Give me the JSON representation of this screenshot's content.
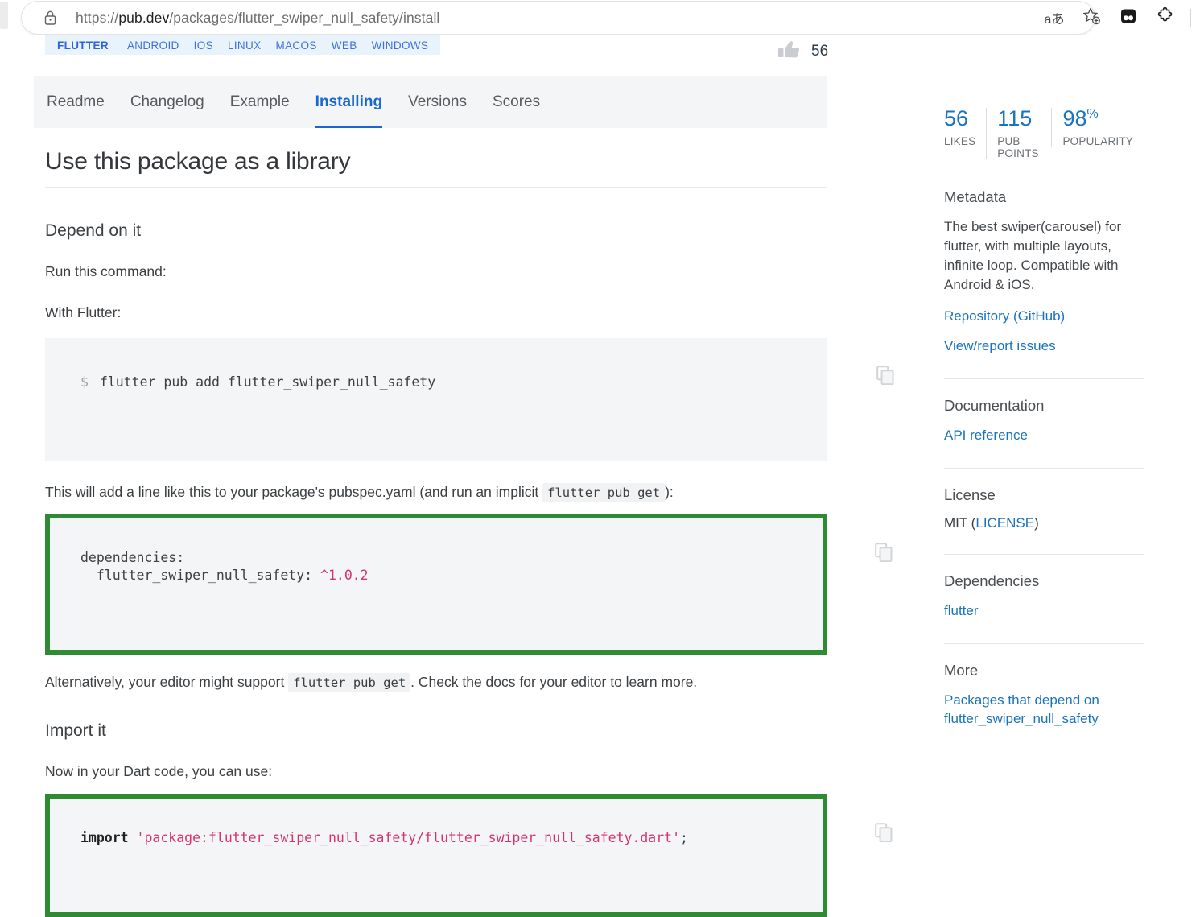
{
  "browser": {
    "url_scheme": "https://",
    "url_host": "pub.dev",
    "url_path": "/packages/flutter_swiper_null_safety/install",
    "url_full": "https://pub.dev/packages/flutter_swiper_null_safety/install",
    "actions": {
      "read_aloud_label": "aあ",
      "favorite_label": "add-favorite",
      "collections_label": "collections",
      "extensions_label": "extensions"
    }
  },
  "platforms": {
    "primary": "FLUTTER",
    "items": [
      "ANDROID",
      "IOS",
      "LINUX",
      "MACOS",
      "WEB",
      "WINDOWS"
    ]
  },
  "likes": {
    "icon": "thumb-up-icon",
    "count": "56"
  },
  "tabs": [
    {
      "label": "Readme",
      "active": false
    },
    {
      "label": "Changelog",
      "active": false
    },
    {
      "label": "Example",
      "active": false
    },
    {
      "label": "Installing",
      "active": true
    },
    {
      "label": "Versions",
      "active": false
    },
    {
      "label": "Scores",
      "active": false
    }
  ],
  "main": {
    "title": "Use this package as a library",
    "depend_heading": "Depend on it",
    "run_command_label": "Run this command:",
    "with_flutter_label": "With Flutter:",
    "command_prompt": "$",
    "command_text": "flutter pub add flutter_swiper_null_safety",
    "pubspec_note_before": "This will add a line like this to your package's pubspec.yaml (and run an implicit ",
    "pubspec_note_code": "flutter pub get",
    "pubspec_note_after": "):",
    "dependency_line1": "dependencies:",
    "dependency_pkg": "  flutter_swiper_null_safety: ",
    "dependency_version": "^1.0.2",
    "alt_note_before": "Alternatively, your editor might support ",
    "alt_note_code": "flutter pub get",
    "alt_note_after": ". Check the docs for your editor to learn more.",
    "import_heading": "Import it",
    "import_note": "Now in your Dart code, you can use:",
    "import_keyword": "import",
    "import_string": " 'package:flutter_swiper_null_safety/flutter_swiper_null_safety.dart'",
    "import_semicolon": ";",
    "copy_icon_label": "copy-icon"
  },
  "sidebar": {
    "stats": [
      {
        "value": "56",
        "suffix": "",
        "label": "LIKES"
      },
      {
        "value": "115",
        "suffix": "",
        "label": "PUB POINTS"
      },
      {
        "value": "98",
        "suffix": "%",
        "label": "POPULARITY"
      }
    ],
    "metadata_heading": "Metadata",
    "metadata_description": "The best swiper(carousel) for flutter, with multiple layouts, infinite loop. Compatible with Android & iOS.",
    "repository_link": "Repository (GitHub)",
    "issues_link": "View/report issues",
    "documentation_heading": "Documentation",
    "api_reference_link": "API reference",
    "license_heading": "License",
    "license_prefix": "MIT (",
    "license_link": "LICENSE",
    "license_suffix": ")",
    "dependencies_heading": "Dependencies",
    "dependency_link": "flutter",
    "more_heading": "More",
    "more_link": "Packages that depend on flutter_swiper_null_safety"
  },
  "colors": {
    "accent_blue": "#1a73bd",
    "tab_active": "#1967d2",
    "highlight_green": "#2e8b33",
    "code_string_red": "#d6336c",
    "chip_bg": "#e8f3fc"
  }
}
